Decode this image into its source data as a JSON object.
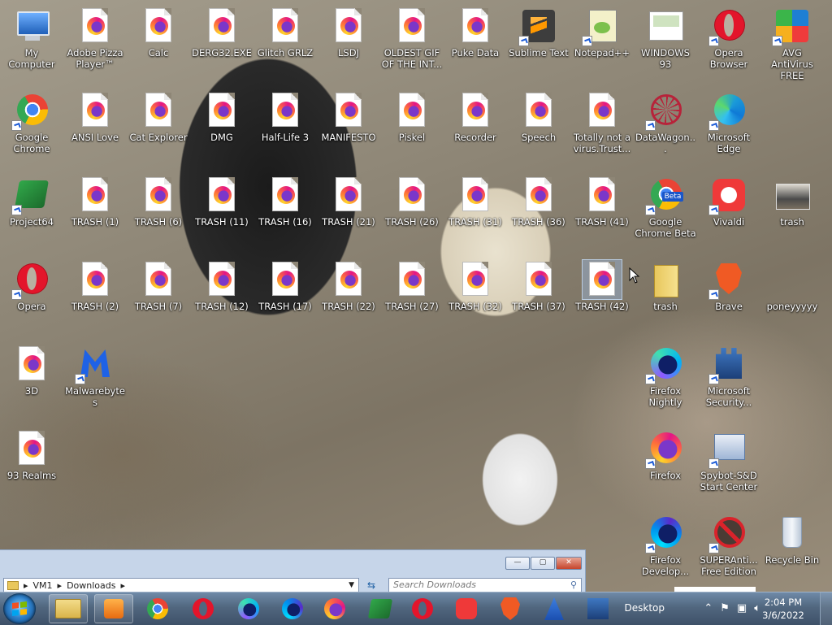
{
  "desktop": {
    "icons": [
      {
        "label": "My Computer",
        "kind": "computer"
      },
      {
        "label": "Adobe Pizza Player™",
        "kind": "ffdoc"
      },
      {
        "label": "Calc",
        "kind": "ffdoc"
      },
      {
        "label": "DERG32.EXE",
        "kind": "ffdoc"
      },
      {
        "label": "Glitch GRLZ",
        "kind": "ffdoc"
      },
      {
        "label": "LSDJ",
        "kind": "ffdoc"
      },
      {
        "label": "OLDEST GIF OF THE INT...",
        "kind": "ffdoc"
      },
      {
        "label": "Puke Data",
        "kind": "ffdoc"
      },
      {
        "label": "Sublime Text",
        "kind": "sublime"
      },
      {
        "label": "Notepad++",
        "kind": "notepad"
      },
      {
        "label": "WINDOWS 93",
        "kind": "win93"
      },
      {
        "label": "Opera Browser",
        "kind": "opera"
      },
      {
        "label": "AVG AntiVirus FREE",
        "kind": "avg"
      },
      {
        "label": "Google Chrome",
        "kind": "chrome"
      },
      {
        "label": "ANSI Love",
        "kind": "ffdoc"
      },
      {
        "label": "Cat Explorer",
        "kind": "ffdoc"
      },
      {
        "label": "DMG",
        "kind": "ffdoc"
      },
      {
        "label": "Half-Life 3",
        "kind": "ffdoc"
      },
      {
        "label": "MANIFESTO",
        "kind": "ffdoc"
      },
      {
        "label": "Piskel",
        "kind": "ffdoc"
      },
      {
        "label": "Recorder",
        "kind": "ffdoc"
      },
      {
        "label": "Speech",
        "kind": "ffdoc"
      },
      {
        "label": "Totally not a virus.Trust...",
        "kind": "ffdoc"
      },
      {
        "label": "DataWagon...",
        "kind": "datawagon"
      },
      {
        "label": "Microsoft Edge",
        "kind": "edge"
      },
      {
        "label": "Project64",
        "kind": "project64"
      },
      {
        "label": "TRASH (1)",
        "kind": "ffdoc"
      },
      {
        "label": "TRASH (6)",
        "kind": "ffdoc"
      },
      {
        "label": "TRASH (11)",
        "kind": "ffdoc"
      },
      {
        "label": "TRASH (16)",
        "kind": "ffdoc"
      },
      {
        "label": "TRASH (21)",
        "kind": "ffdoc"
      },
      {
        "label": "TRASH (26)",
        "kind": "ffdoc"
      },
      {
        "label": "TRASH (31)",
        "kind": "ffdoc"
      },
      {
        "label": "TRASH (36)",
        "kind": "ffdoc"
      },
      {
        "label": "TRASH (41)",
        "kind": "ffdoc"
      },
      {
        "label": "Google Chrome Beta",
        "kind": "chromebeta"
      },
      {
        "label": "Vivaldi",
        "kind": "vivaldi"
      },
      {
        "label": "trash",
        "kind": "photo"
      },
      {
        "label": "Opera",
        "kind": "opera"
      },
      {
        "label": "TRASH (2)",
        "kind": "ffdoc"
      },
      {
        "label": "TRASH (7)",
        "kind": "ffdoc"
      },
      {
        "label": "TRASH (12)",
        "kind": "ffdoc"
      },
      {
        "label": "TRASH (17)",
        "kind": "ffdoc"
      },
      {
        "label": "TRASH (22)",
        "kind": "ffdoc"
      },
      {
        "label": "TRASH (27)",
        "kind": "ffdoc"
      },
      {
        "label": "TRASH (32)",
        "kind": "ffdoc"
      },
      {
        "label": "TRASH (37)",
        "kind": "ffdoc"
      },
      {
        "label": "TRASH (42)",
        "kind": "ffdoc"
      },
      {
        "label": "trash",
        "kind": "folder"
      },
      {
        "label": "Brave",
        "kind": "brave"
      },
      {
        "label": "poneyyyyy",
        "kind": "blank"
      },
      {
        "label": "3D",
        "kind": "ffdoc"
      },
      {
        "label": "Malwarebytes",
        "kind": "malwarebytes"
      },
      {
        "label": "Firefox Nightly",
        "kind": "nightly"
      },
      {
        "label": "Microsoft Security...",
        "kind": "mssecurity"
      },
      {
        "label": "93 Realms",
        "kind": "ffdoc"
      },
      {
        "label": "Firefox",
        "kind": "firefox"
      },
      {
        "label": "Spybot-S&D Start Center",
        "kind": "spybot"
      },
      {
        "label": "Firefox Develop...",
        "kind": "ffdev"
      },
      {
        "label": "SUPERAnti... Free Edition",
        "kind": "superanti"
      },
      {
        "label": "Recycle Bin",
        "kind": "recycle"
      }
    ]
  },
  "window": {
    "minimize": "—",
    "maximize": "▢",
    "close": "✕",
    "address": {
      "segments": [
        "VM1",
        "Downloads"
      ]
    },
    "search_placeholder": "Search Downloads"
  },
  "taskbar": {
    "apps": [
      "explorer",
      "media-player",
      "chrome",
      "opera",
      "firefox-nightly",
      "firefox-dev",
      "firefox",
      "project64",
      "opera",
      "vivaldi",
      "brave",
      "bluetooth-app",
      "ms-security"
    ],
    "desktop_label": "Desktop",
    "clock": {
      "time": "2:04 PM",
      "date": "3/6/2022"
    }
  }
}
